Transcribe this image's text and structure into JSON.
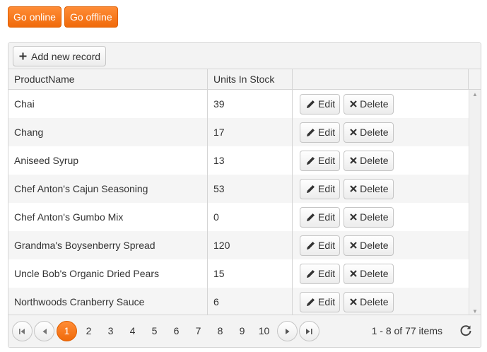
{
  "top_buttons": {
    "go_online": "Go online",
    "go_offline": "Go offline"
  },
  "toolbar": {
    "add_label": "Add new record"
  },
  "columns": {
    "product_name": "ProductName",
    "units_in_stock": "Units In Stock"
  },
  "actions": {
    "edit": "Edit",
    "delete": "Delete"
  },
  "rows": [
    {
      "name": "Chai",
      "units": "39"
    },
    {
      "name": "Chang",
      "units": "17"
    },
    {
      "name": "Aniseed Syrup",
      "units": "13"
    },
    {
      "name": "Chef Anton's Cajun Seasoning",
      "units": "53"
    },
    {
      "name": "Chef Anton's Gumbo Mix",
      "units": "0"
    },
    {
      "name": "Grandma's Boysenberry Spread",
      "units": "120"
    },
    {
      "name": "Uncle Bob's Organic Dried Pears",
      "units": "15"
    },
    {
      "name": "Northwoods Cranberry Sauce",
      "units": "6"
    }
  ],
  "pager": {
    "pages": [
      "1",
      "2",
      "3",
      "4",
      "5",
      "6",
      "7",
      "8",
      "9",
      "10"
    ],
    "current_page": "1",
    "info": "1 - 8 of 77 items"
  },
  "colors": {
    "accent": "#f47b20"
  }
}
